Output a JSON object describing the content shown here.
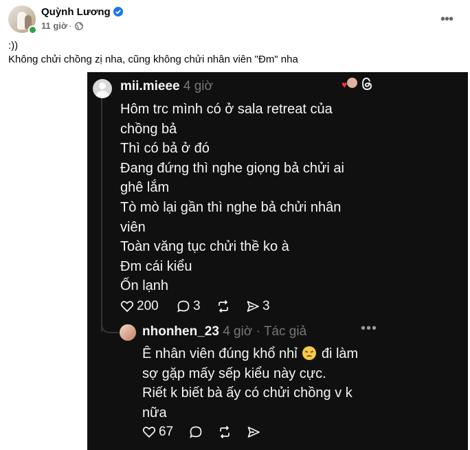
{
  "post": {
    "author": "Quỳnh Lương",
    "time": "11 giờ",
    "separator": "·",
    "icons": {
      "verified": "verified-badge-icon",
      "audience": "globe-icon",
      "more": "more-options-icon"
    },
    "caption_lines": [
      ":))",
      "Không chửi chồng zị nha, cũng không chửi nhân viên \"Đm\" nha"
    ]
  },
  "threads": {
    "comment": {
      "username": "mii.mieee",
      "time": "4 giờ",
      "lines": [
        "Hôm trc mình có ở sala retreat của",
        "chồng bả",
        "Thì có bả ở đó",
        "Đang đứng thì nghe giọng bả chửi ai",
        "ghê lắm",
        "Tò mò lại gần thì nghe bả chửi nhân",
        "viên",
        "Toàn văng tục chửi thề ko à",
        "Đm cái kiểu",
        "Ốn lạnh"
      ],
      "likes": "200",
      "replies": "3",
      "shares": "3"
    },
    "reply": {
      "username": "nhonhen_23",
      "time": "4 giờ",
      "author_tag": "· Tác giả",
      "line1_before": "Ê nhân viên đúng khổ nhỉ",
      "line1_after": "đi làm",
      "lines": [
        "sợ gặp mấy sếp kiểu này cực.",
        "Riết k biết bà ấy có chửi chồng v k",
        "nữa"
      ],
      "likes": "67"
    },
    "colors": {
      "background": "#101010",
      "text": "#f3f5f7",
      "muted": "#777777"
    }
  }
}
